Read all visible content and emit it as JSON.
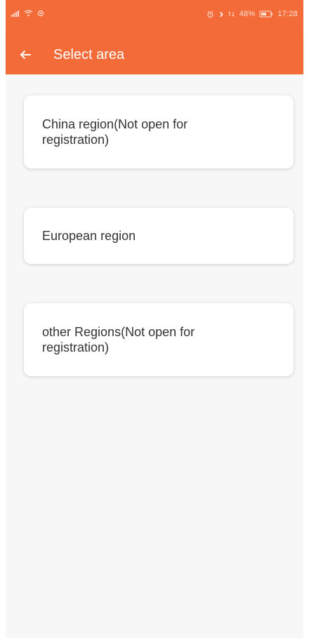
{
  "status_bar": {
    "signal_icon": "signal-icon",
    "wifi_icon": "wifi-icon",
    "location_icon": "location-icon",
    "alarm_icon": "alarm-icon",
    "bluetooth_icon": "bluetooth-icon",
    "data_icon": "data-icon",
    "battery_percent": "48%",
    "time": "17:28"
  },
  "app_bar": {
    "title": "Select area",
    "back_icon": "back-arrow-icon"
  },
  "regions": [
    {
      "label": "China region(Not open for registration)"
    },
    {
      "label": "European region"
    },
    {
      "label": "other Regions(Not open for registration)"
    }
  ],
  "colors": {
    "brand": "#f26b38",
    "background": "#f7f7f7",
    "card": "#ffffff",
    "text": "#333333"
  }
}
